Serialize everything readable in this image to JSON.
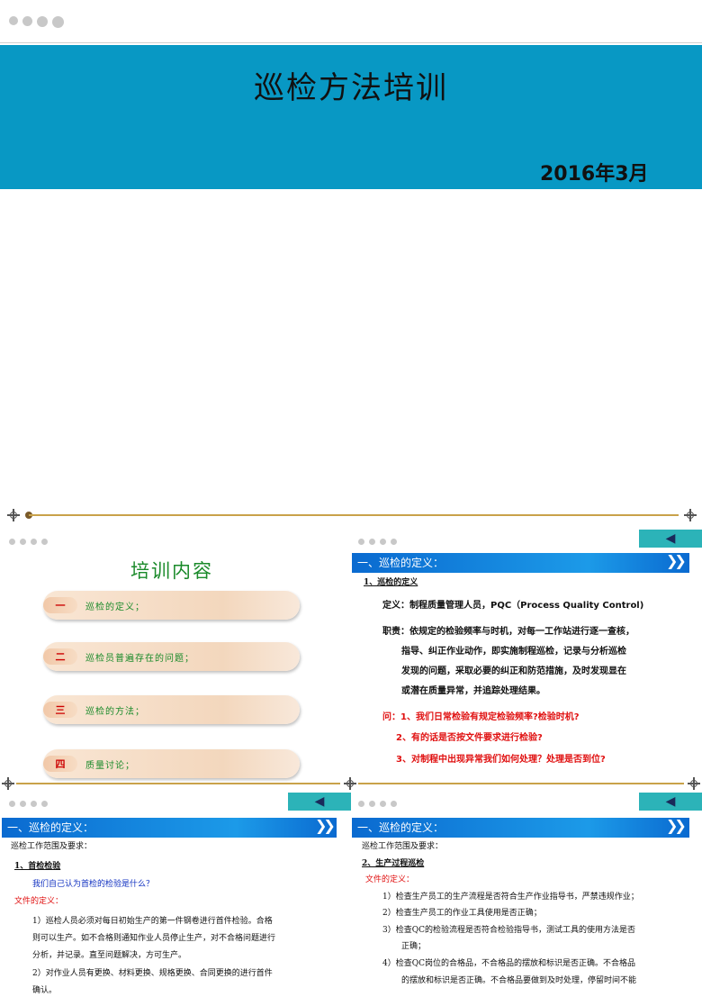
{
  "title_slide": {
    "title": "巡检方法培训",
    "date": "2016年3月"
  },
  "nav": {
    "arrow": "◀"
  },
  "toc": {
    "title": "培训内容",
    "items": [
      {
        "num": "一",
        "label": "巡检的定义；"
      },
      {
        "num": "二",
        "label": "巡检员普遍存在的问题；"
      },
      {
        "num": "三",
        "label": "巡检的方法；"
      },
      {
        "num": "四",
        "label": "质量讨论；"
      }
    ]
  },
  "definition": {
    "header": "一、巡检的定义：",
    "chevron": "❯❯",
    "sub": "1、巡检的定义",
    "def_line": "定义：制程质量管理人员，PQC（Process Quality Control)",
    "duty_lines": [
      "职责：依规定的检验频率与时机，对每一工作站进行逐一查核，",
      "指导、纠正作业动作，即实施制程巡检，记录与分析巡检",
      "发现的问题，采取必要的纠正和防范措施，及时发现显在",
      "或潜在质量异常，并追踪处理结果。"
    ],
    "questions": [
      "问：1、我们日常检验有规定检验频率?检验时机?",
      "2、有的话是否按文件要求进行检验?",
      "3、对制程中出现异常我们如何处理？处理是否到位?"
    ]
  },
  "first_check": {
    "header": "一、巡检的定义：",
    "chevron": "❯❯",
    "scope": "巡检工作范围及要求：",
    "sub": "1、首检检验",
    "question": "我们自己认为首检的检验是什么？",
    "doc_req": "文件的定义：",
    "lines": [
      "1）巡检人员必须对每日初始生产的第一件钢卷进行首件检验。合格",
      "则可以生产。如不合格则通知作业人员停止生产，对不合格问题进行",
      "分析，并记录。直至问题解决，方可生产。",
      "2）对作业人员有更换、材料更换、规格更换、合同更换的进行首件",
      "确认。"
    ]
  },
  "process_check": {
    "header": "一、巡检的定义：",
    "chevron": "❯❯",
    "scope": "巡检工作范围及要求：",
    "sub": "2、生产过程巡检",
    "doc_req": "文件的定义：",
    "lines": [
      "1）检查生产员工的生产流程是否符合生产作业指导书，严禁违规作业；",
      "2）检查生产员工的作业工具使用是否正确；",
      "3）检查QC的检验流程是否符合检验指导书，测试工具的使用方法是否",
      "正确；",
      "4）检查QC岗位的合格品，不合格品的摆放和标识是否正确。不合格品",
      "的摆放和标识是否正确。不合格品要做到及时处理，停留时间不能"
    ]
  }
}
